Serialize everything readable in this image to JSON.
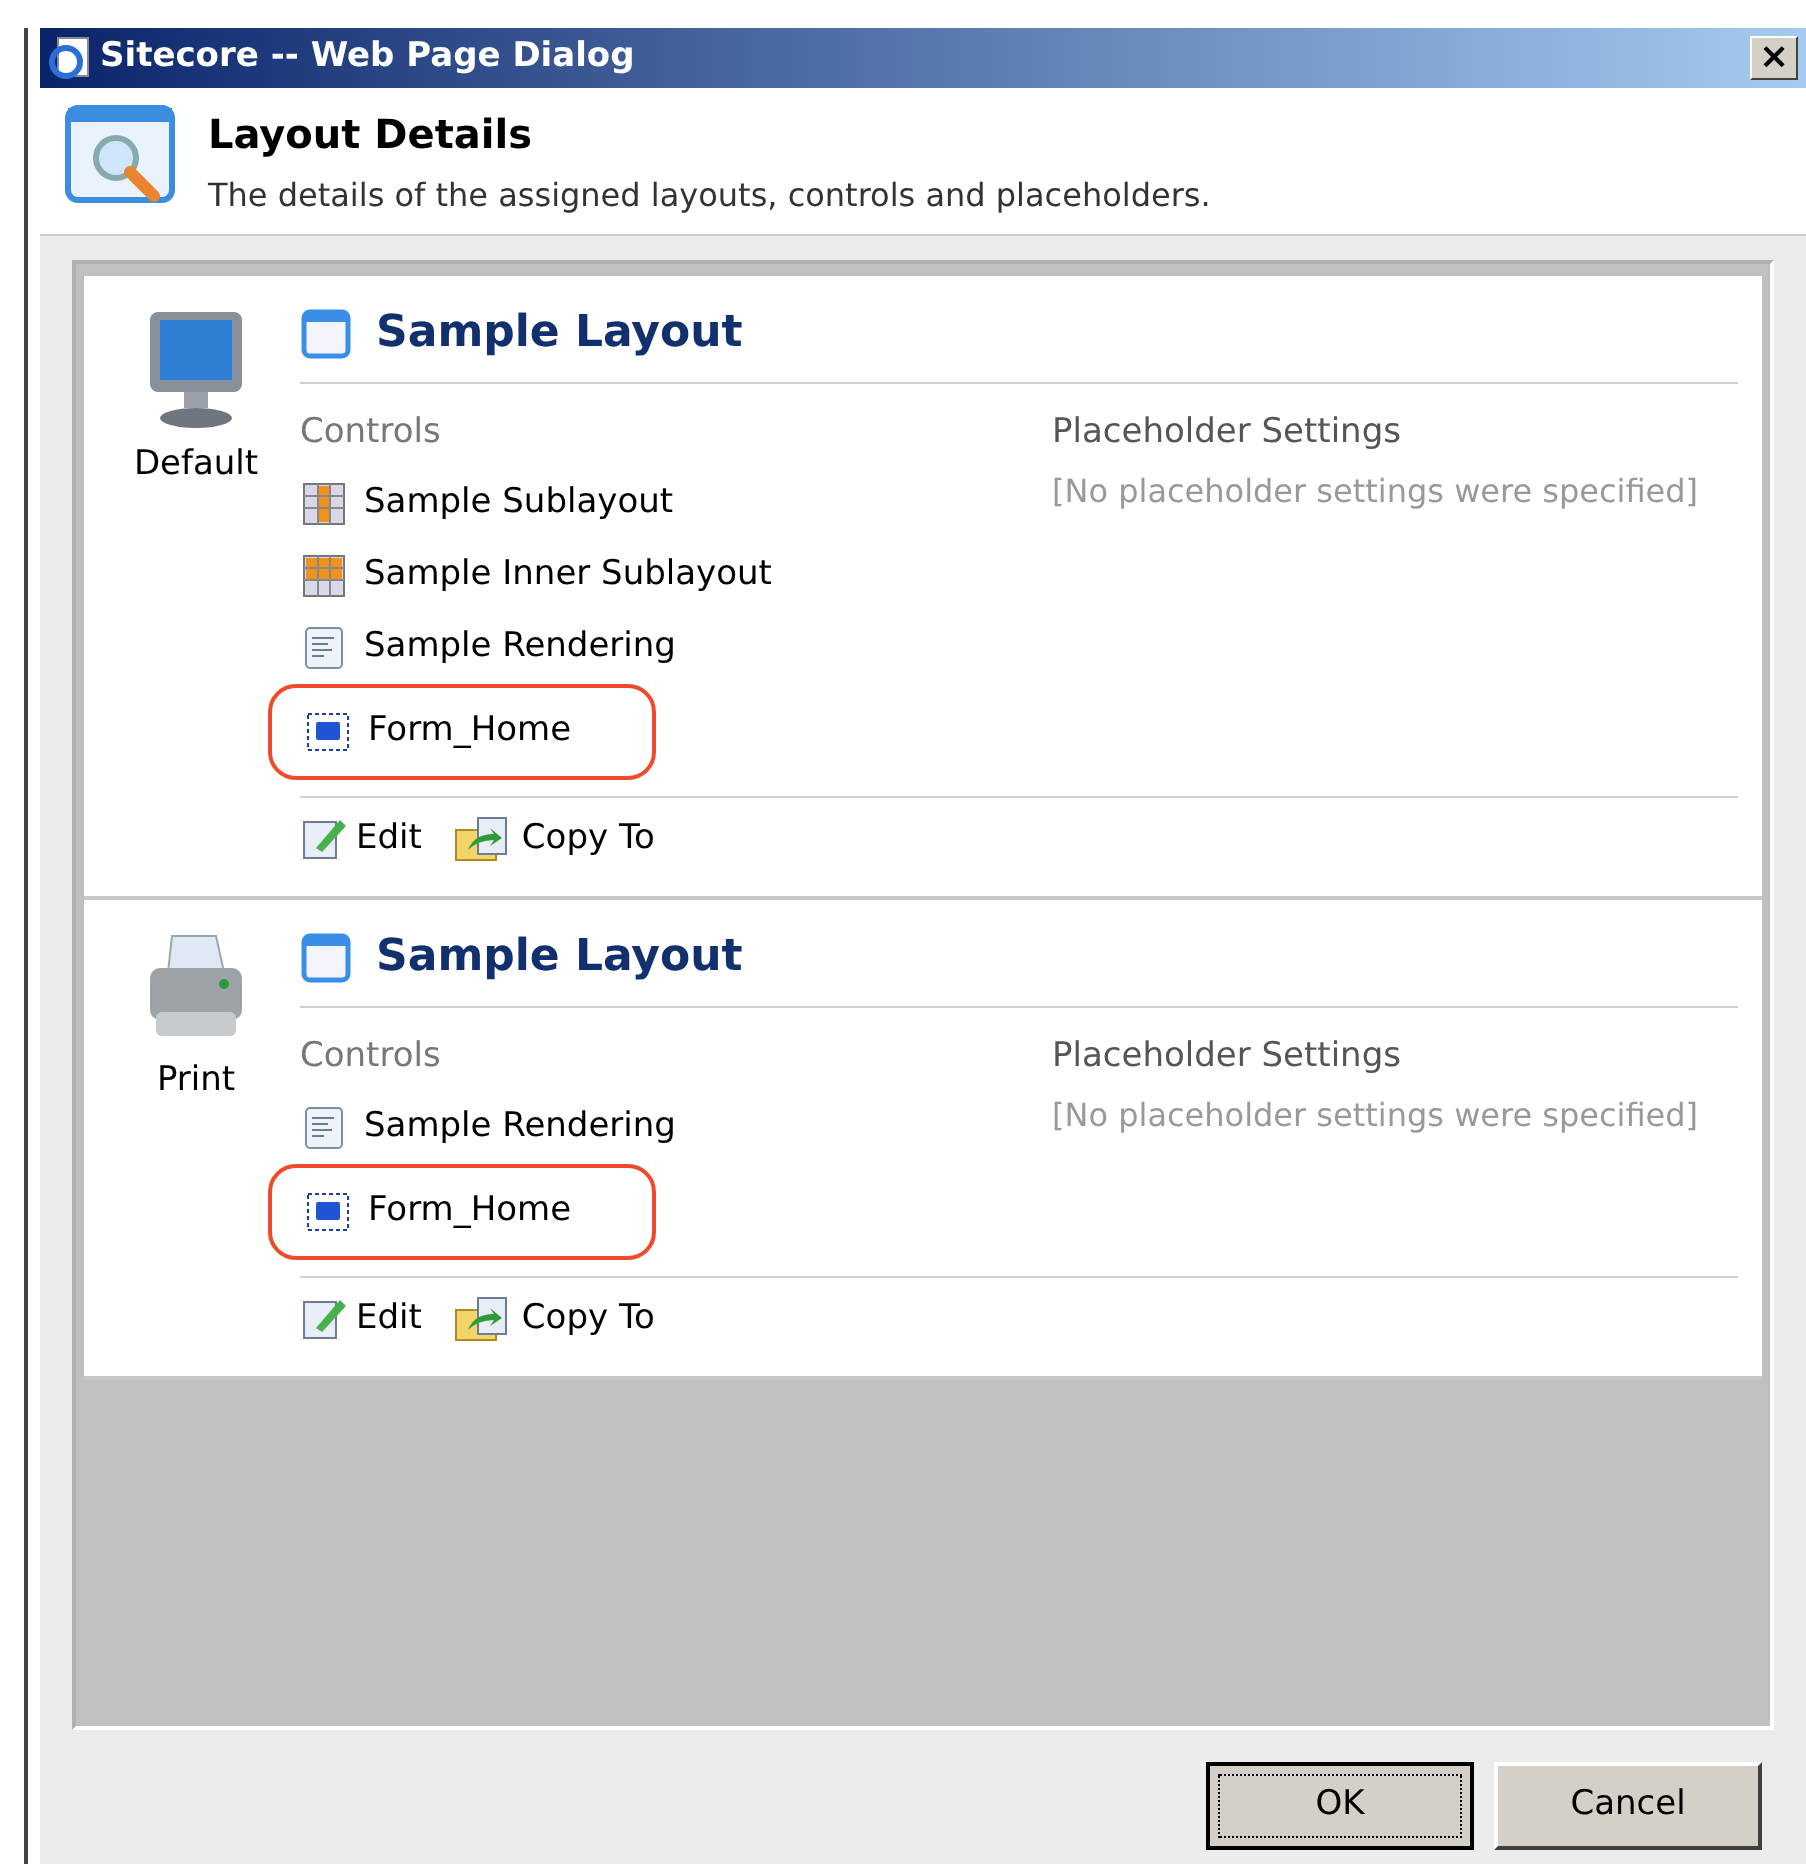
{
  "window": {
    "title": "Sitecore -- Web Page Dialog",
    "close": "×"
  },
  "header": {
    "title": "Layout Details",
    "description": "The details of the assigned layouts, controls and placeholders."
  },
  "devices": [
    {
      "name": "Default",
      "kind": "monitor",
      "layout": "Sample Layout",
      "controls_label": "Controls",
      "controls": [
        {
          "name": "Sample Sublayout",
          "kind": "sublayout",
          "highlighted": false
        },
        {
          "name": "Sample Inner Sublayout",
          "kind": "inner-sublayout",
          "highlighted": false
        },
        {
          "name": "Sample Rendering",
          "kind": "rendering",
          "highlighted": false
        },
        {
          "name": "Form_Home",
          "kind": "form",
          "highlighted": true
        }
      ],
      "placeholder_label": "Placeholder Settings",
      "placeholder_text": "[No placeholder settings were specified]",
      "actions": [
        {
          "label": "Edit",
          "kind": "edit"
        },
        {
          "label": "Copy To",
          "kind": "copy"
        }
      ]
    },
    {
      "name": "Print",
      "kind": "printer",
      "layout": "Sample Layout",
      "controls_label": "Controls",
      "controls": [
        {
          "name": "Sample Rendering",
          "kind": "rendering",
          "highlighted": false
        },
        {
          "name": "Form_Home",
          "kind": "form",
          "highlighted": true
        }
      ],
      "placeholder_label": "Placeholder Settings",
      "placeholder_text": "[No placeholder settings were specified]",
      "actions": [
        {
          "label": "Edit",
          "kind": "edit"
        },
        {
          "label": "Copy To",
          "kind": "copy"
        }
      ]
    }
  ],
  "buttons": [
    {
      "label": "OK",
      "default": true
    },
    {
      "label": "Cancel",
      "default": false
    }
  ]
}
